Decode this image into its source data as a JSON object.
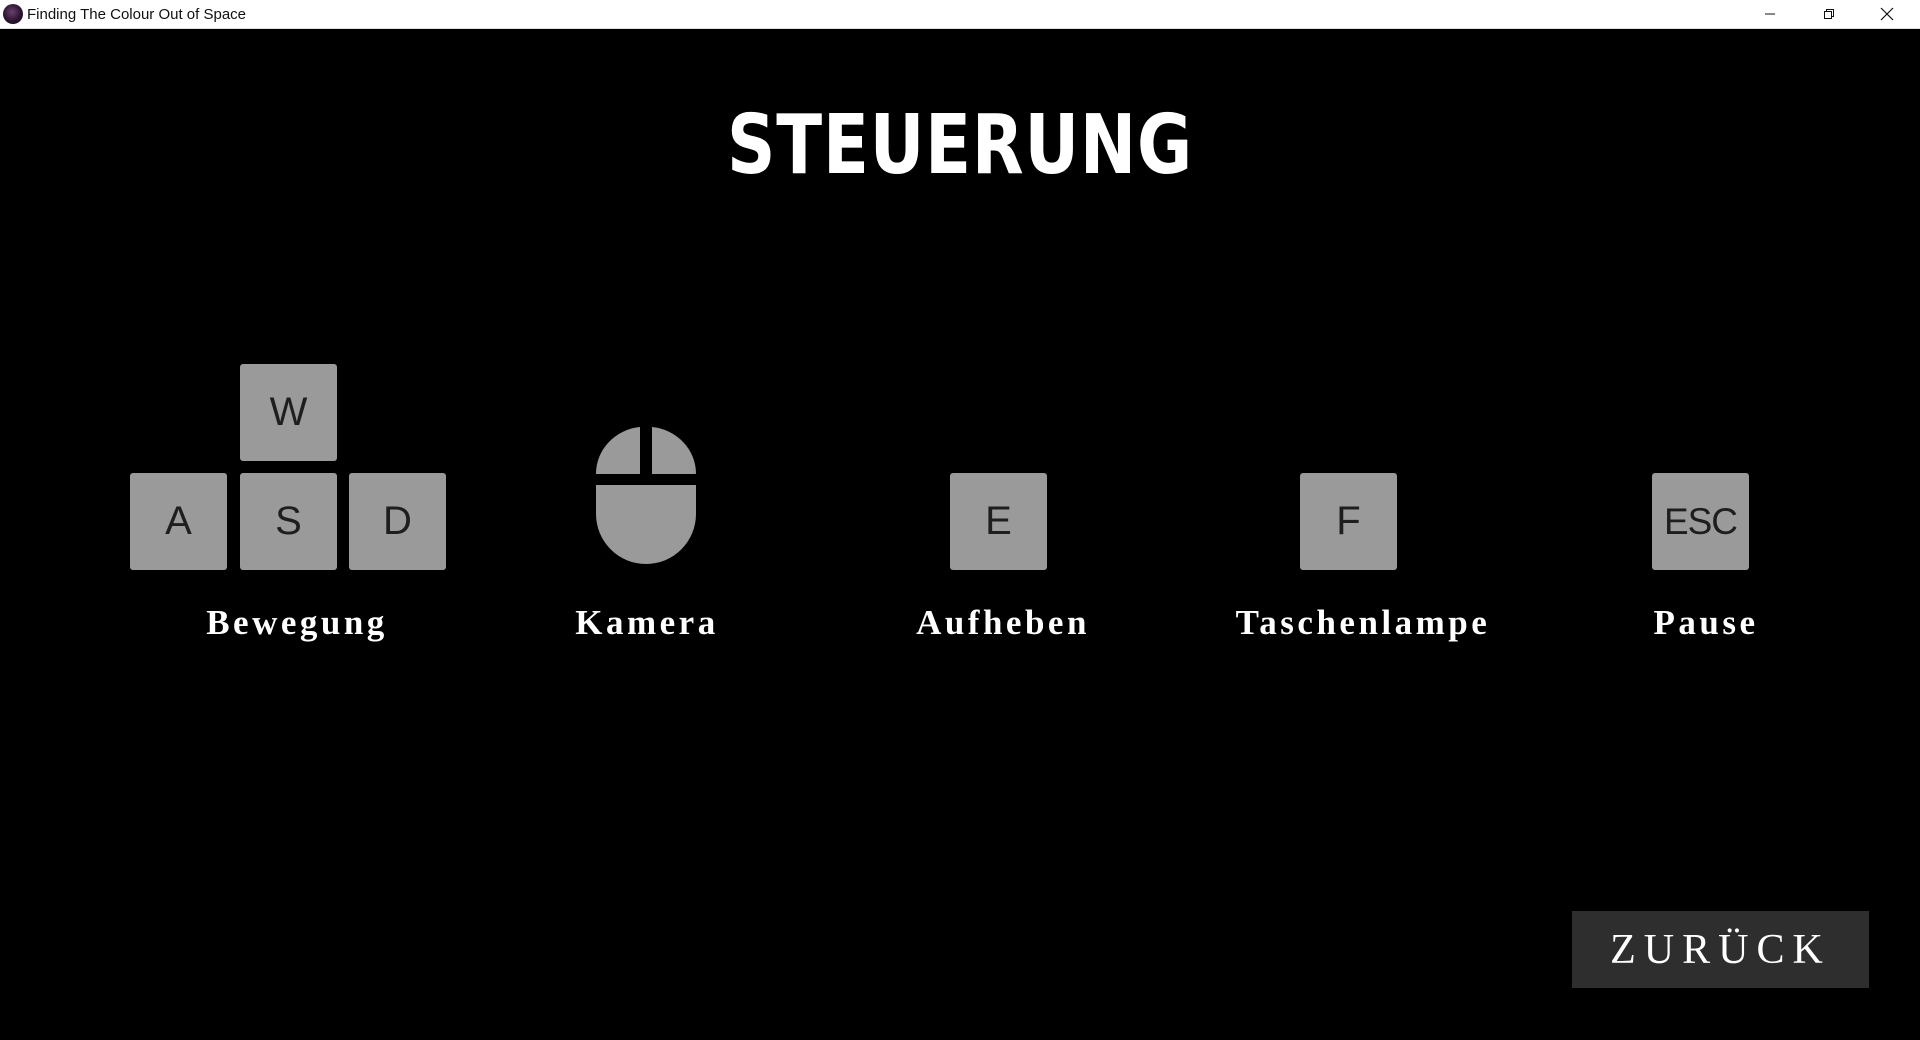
{
  "window": {
    "title": "Finding The Colour Out of Space",
    "app_icon": "game-logo-icon",
    "controls": [
      "minimize-icon",
      "restore-icon",
      "close-icon"
    ]
  },
  "screen": {
    "title": "STEUERUNG",
    "background_color": "#000000"
  },
  "controls": [
    {
      "keys": [
        "W",
        "A",
        "S",
        "D"
      ],
      "label": "Bewegung"
    },
    {
      "icon": "mouse-icon",
      "label": "Kamera"
    },
    {
      "keys": [
        "E"
      ],
      "label": "Aufheben"
    },
    {
      "keys": [
        "F"
      ],
      "label": "Taschenlampe"
    },
    {
      "keys": [
        "ESC"
      ],
      "label": "Pause"
    }
  ],
  "back_button": {
    "label": "ZURÜCK"
  },
  "colors": {
    "key_fill": "#9a9a9a",
    "key_text": "#1e1e1e",
    "button_fill": "#2e2e2e",
    "text": "#ffffff"
  }
}
